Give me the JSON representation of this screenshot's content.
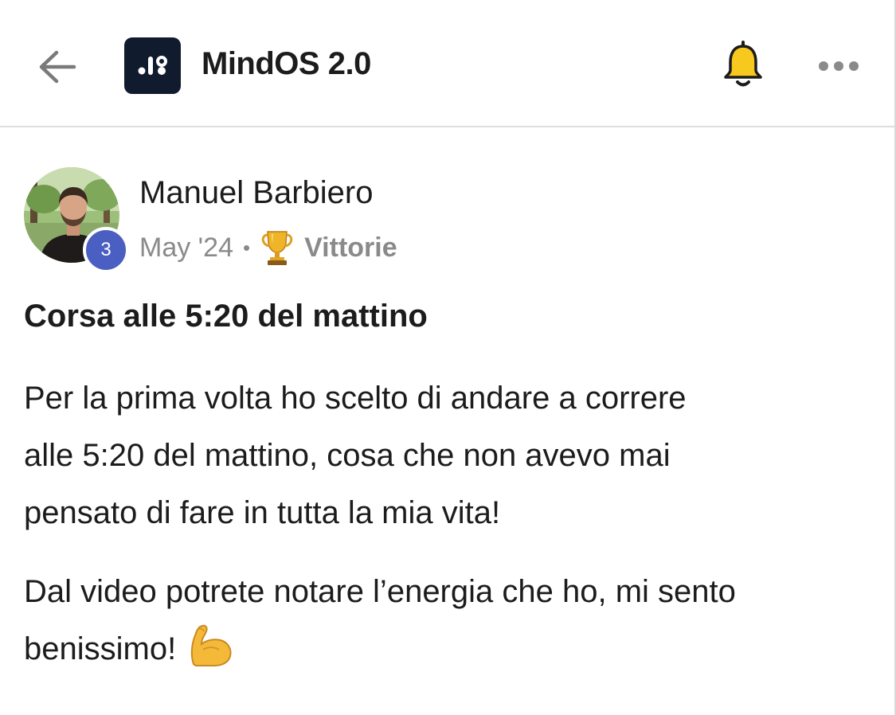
{
  "header": {
    "title": "MindOS 2.0",
    "icons": {
      "back": "arrow-left-icon",
      "logo": "mindos-logo",
      "notifications": "bell-icon",
      "more": "more-horizontal-icon"
    }
  },
  "post": {
    "author": {
      "name": "Manuel Barbiero",
      "level": "3"
    },
    "date": "May '24",
    "separator": "•",
    "category": {
      "label": "Vittorie",
      "icon": "trophy-icon"
    },
    "title": "Corsa alle 5:20 del mattino",
    "paragraphs": [
      "Per la prima volta ho scelto di andare a correre\nalle 5:20 del mattino, cosa che non avevo mai\npensato di fare in tutta la mia vita!",
      "Dal video potrete notare l’energia che ho, mi sento\nbenissimo!"
    ],
    "trailing_icon": "flexed-biceps-icon"
  },
  "colors": {
    "logo_bg": "#111b2e",
    "badge_bg": "#4a5fc1",
    "bell": "#f7c81e",
    "muted_text": "#8a8a8a"
  }
}
